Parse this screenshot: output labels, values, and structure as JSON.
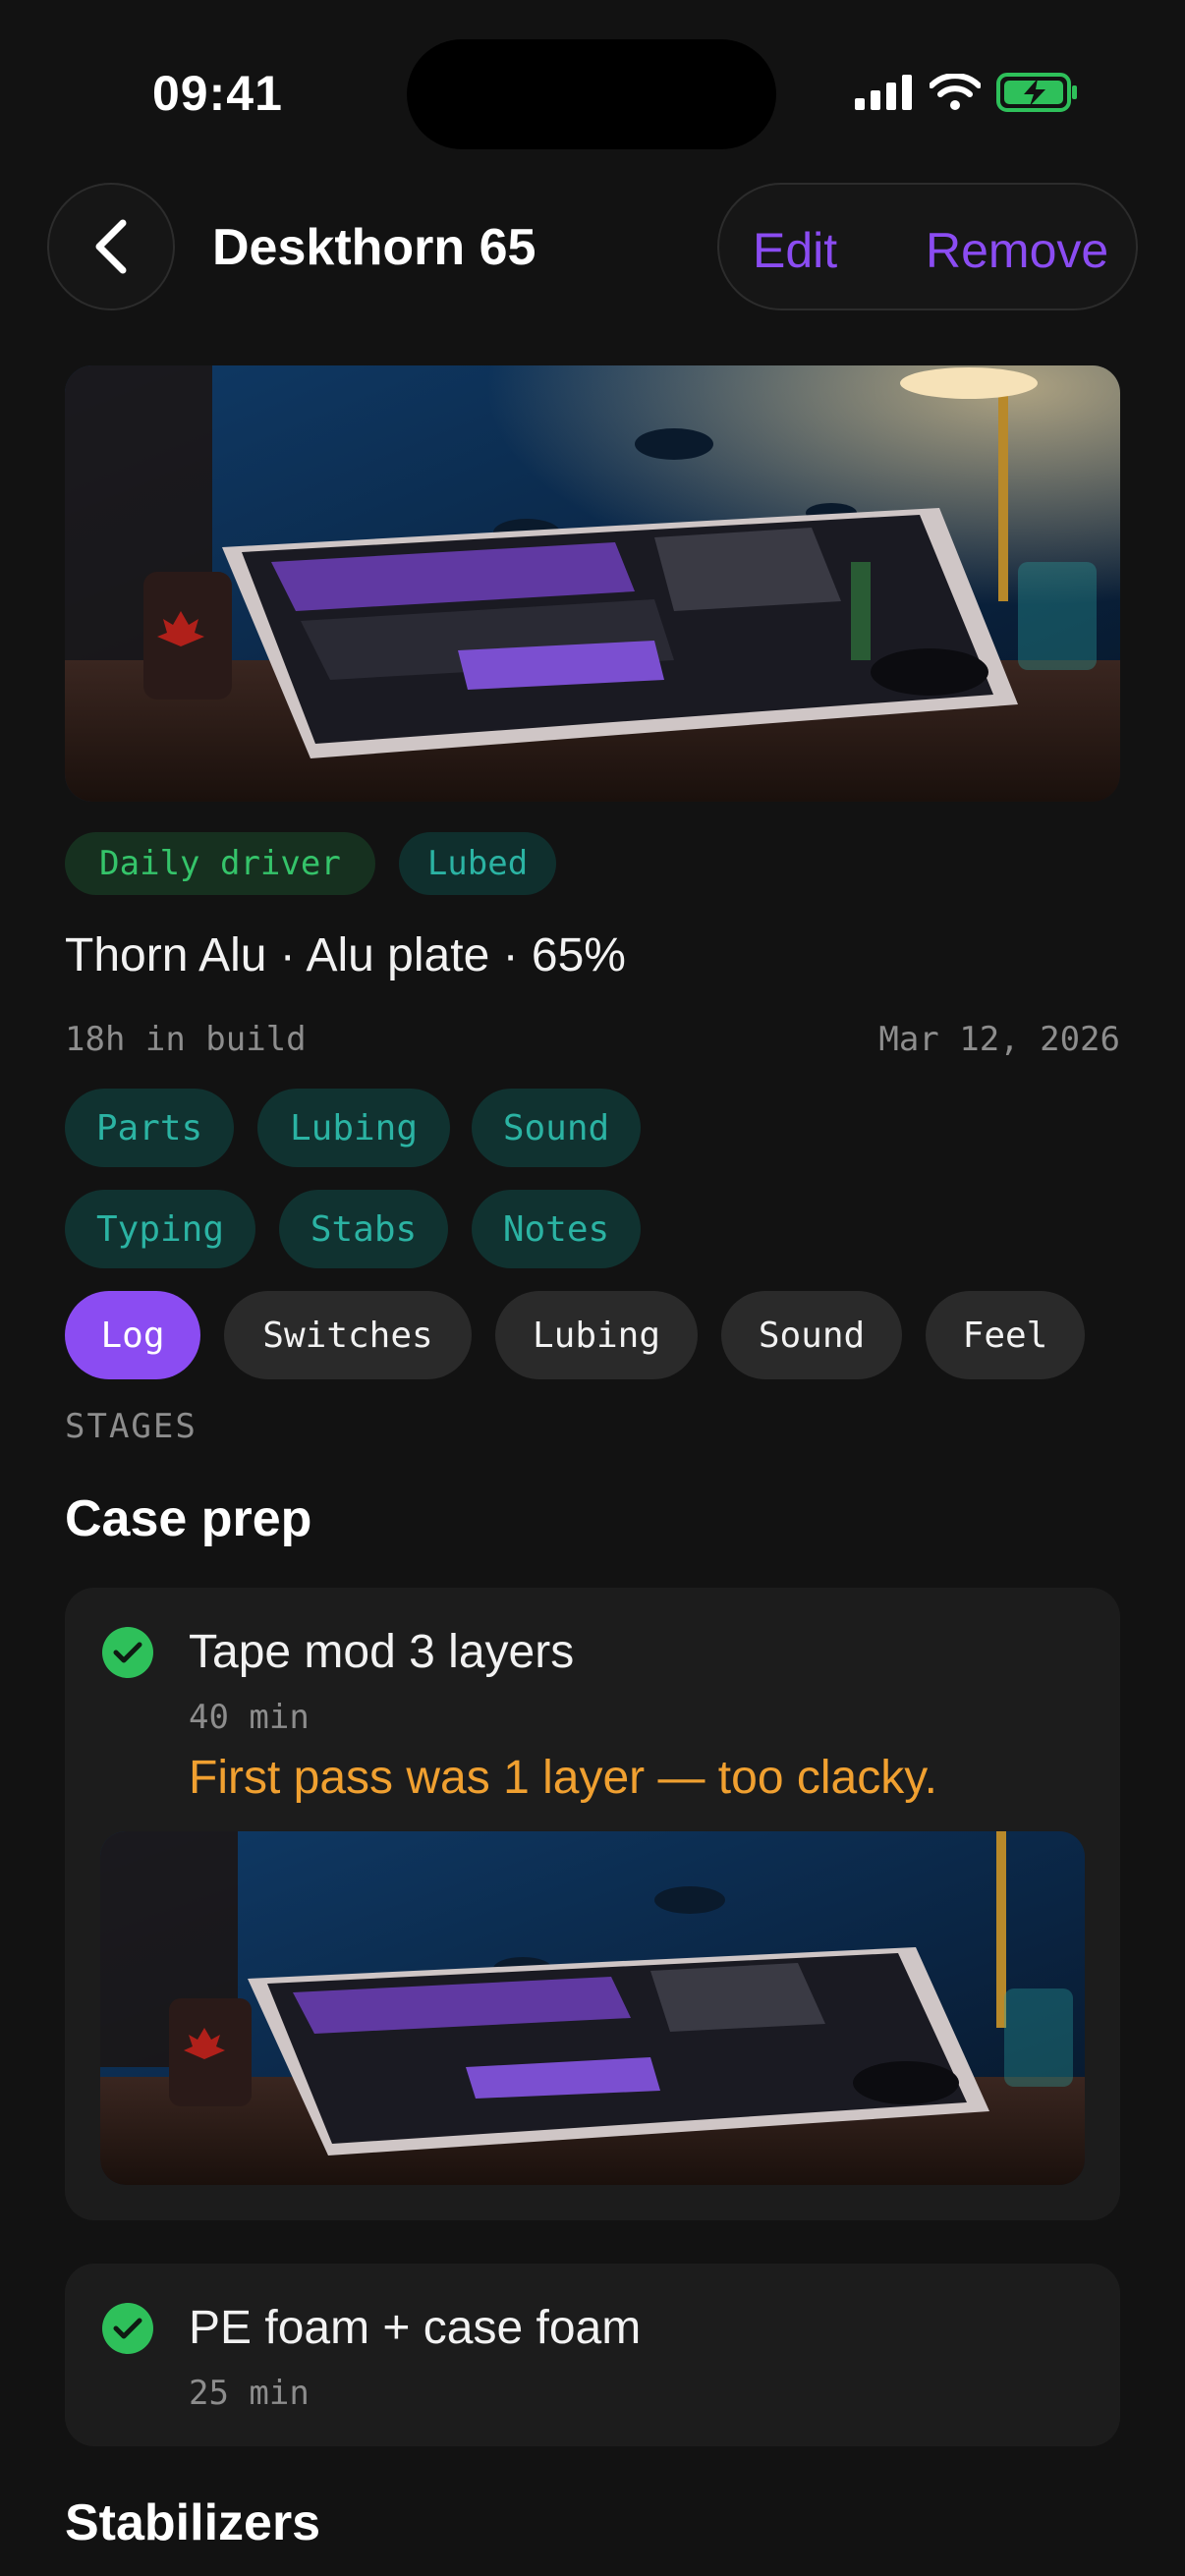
{
  "status": {
    "time": "09:41"
  },
  "header": {
    "title": "Deskthorn 65",
    "edit_label": "Edit",
    "remove_label": "Remove"
  },
  "build": {
    "tags": [
      "Daily driver",
      "Lubed"
    ],
    "spec": "Thorn Alu · Alu plate · 65%",
    "hours": "18h in build",
    "date": "Mar 12, 2026"
  },
  "sections": [
    "Parts",
    "Lubing",
    "Sound",
    "Typing",
    "Stabs",
    "Notes"
  ],
  "tabs": [
    "Log",
    "Switches",
    "Lubing",
    "Sound",
    "Feel"
  ],
  "stages_label": "STAGES",
  "groups": [
    {
      "title": "Case prep",
      "steps": [
        {
          "title": "Tape mod 3 layers",
          "duration": "40 min",
          "note": "First pass was 1 layer — too clacky."
        },
        {
          "title": "PE foam + case foam",
          "duration": "25 min"
        }
      ]
    },
    {
      "title": "Stabilizers"
    }
  ],
  "colors": {
    "accent": "#8b4cf2",
    "teal": "#2bb3a3",
    "green": "#35c46a",
    "note": "#f0a030",
    "check": "#2ec05a"
  }
}
